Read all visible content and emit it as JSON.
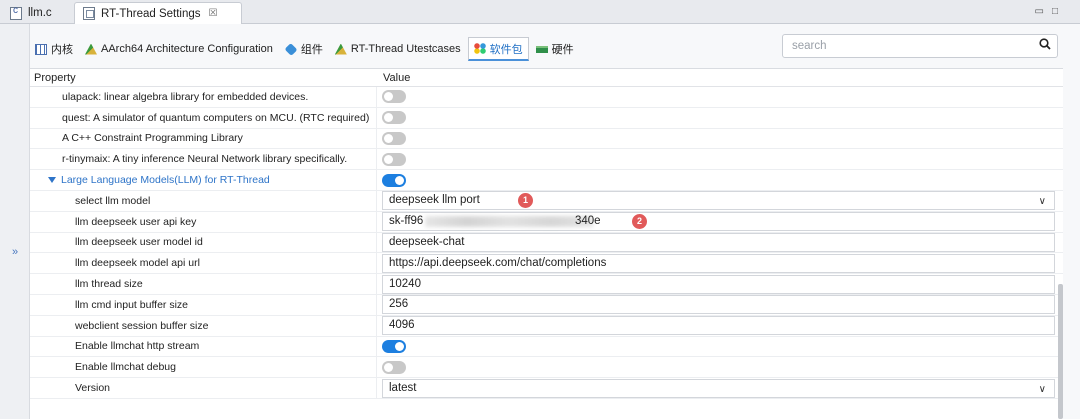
{
  "editor_tabs": [
    {
      "label": "llm.c"
    },
    {
      "label": "RT-Thread Settings",
      "close": "☒"
    }
  ],
  "page_tabs": [
    {
      "label": "内核",
      "icon": "grid-icon"
    },
    {
      "label": "AArch64 Architecture Configuration",
      "icon": "chip-icon"
    },
    {
      "label": "组件",
      "icon": "cube-icon"
    },
    {
      "label": "RT-Thread Utestcases",
      "icon": "chip-icon"
    },
    {
      "label": "软件包",
      "icon": "dots-icon",
      "active": true
    },
    {
      "label": "硬件",
      "icon": "hardware-icon"
    }
  ],
  "search": {
    "placeholder": "search"
  },
  "table": {
    "col_property": "Property",
    "col_value": "Value"
  },
  "rows": [
    {
      "name": "ulapack: linear algebra library for embedded devices.",
      "type": "toggle",
      "on": false
    },
    {
      "name": "quest: A simulator of quantum computers on MCU. (RTC required)",
      "type": "toggle",
      "on": false
    },
    {
      "name": "A C++ Constraint Programming Library",
      "type": "toggle",
      "on": false
    },
    {
      "name": "r-tinymaix: A tiny inference Neural Network library specifically.",
      "type": "toggle",
      "on": false
    },
    {
      "name": "Large Language Models(LLM) for RT-Thread",
      "type": "toggle",
      "on": true,
      "group": true
    },
    {
      "name": "select llm model",
      "type": "select",
      "value": "deepseek llm port",
      "badge": "1"
    },
    {
      "name": "llm deepseek user api key",
      "type": "text",
      "value_start": "sk-ff96",
      "value_end": "340e",
      "badge": "2"
    },
    {
      "name": "llm deepseek user model id",
      "type": "text",
      "value": "deepseek-chat"
    },
    {
      "name": "llm deepseek model api url",
      "type": "text",
      "value": "https://api.deepseek.com/chat/completions"
    },
    {
      "name": "llm thread size",
      "type": "text",
      "value": "10240"
    },
    {
      "name": "llm cmd input buffer size",
      "type": "text",
      "value": "256"
    },
    {
      "name": "webclient session buffer size",
      "type": "text",
      "value": "4096"
    },
    {
      "name": "Enable llmchat http stream",
      "type": "toggle",
      "on": true
    },
    {
      "name": "Enable llmchat debug",
      "type": "toggle",
      "on": false
    },
    {
      "name": "Version",
      "type": "select",
      "value": "latest"
    }
  ],
  "colors": {
    "accent": "#1d7fe0",
    "badge": "#e15a5a",
    "group_text": "#2e74c8"
  }
}
